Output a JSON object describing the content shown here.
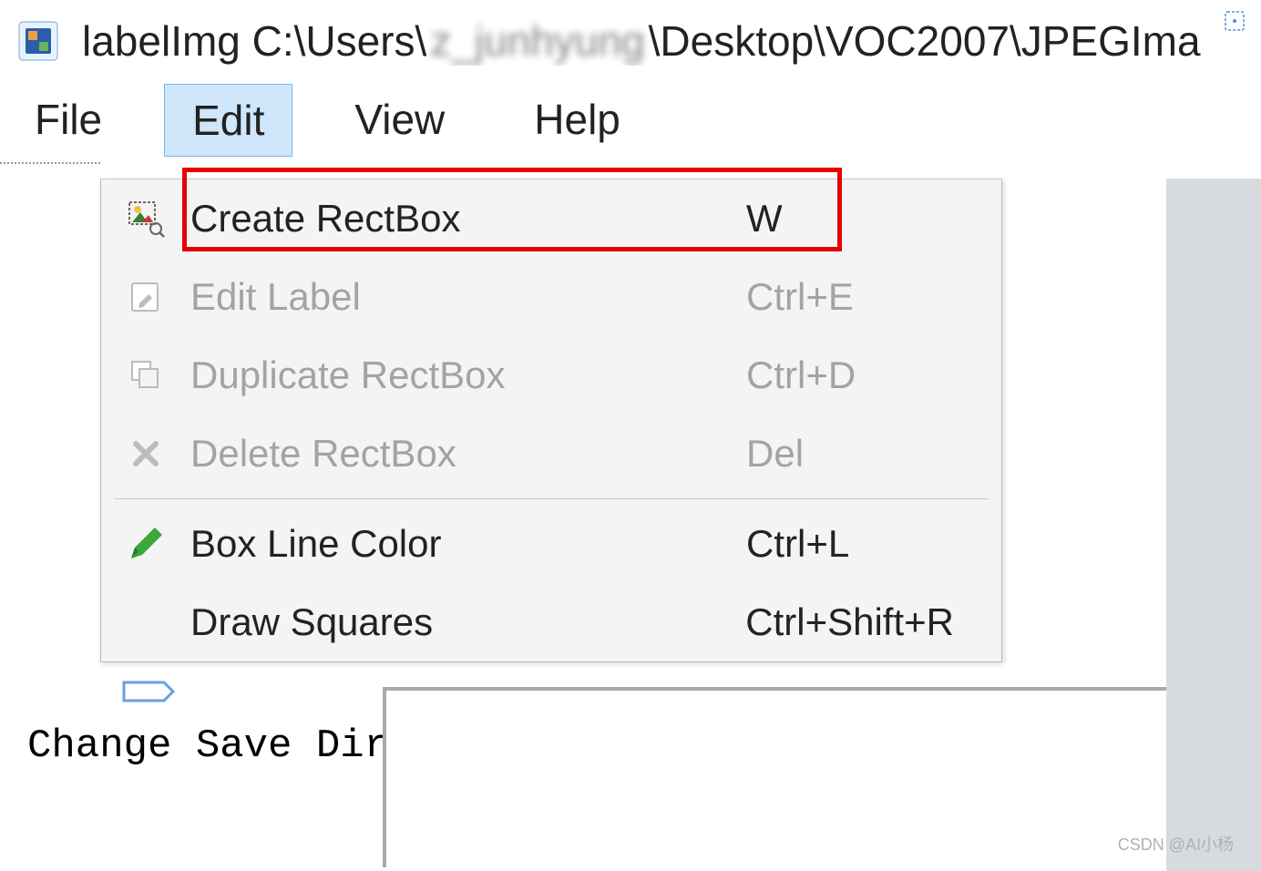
{
  "title": {
    "app_name": "labelImg",
    "path_prefix": "C:\\Users\\",
    "path_blurred": "z_junhyung",
    "path_suffix": "\\Desktop\\VOC2007\\JPEGIma"
  },
  "menubar": {
    "items": [
      "File",
      "Edit",
      "View",
      "Help"
    ],
    "selected_index": 1
  },
  "dropdown": {
    "items": [
      {
        "icon": "create-rect-icon",
        "label": "Create RectBox",
        "shortcut": "W",
        "disabled": false,
        "highlighted": true
      },
      {
        "icon": "edit-icon",
        "label": "Edit Label",
        "shortcut": "Ctrl+E",
        "disabled": true,
        "highlighted": false
      },
      {
        "icon": "duplicate-icon",
        "label": "Duplicate RectBox",
        "shortcut": "Ctrl+D",
        "disabled": true,
        "highlighted": false
      },
      {
        "icon": "delete-icon",
        "label": "Delete RectBox",
        "shortcut": "Del",
        "disabled": true,
        "highlighted": false
      },
      {
        "separator": true
      },
      {
        "icon": "pencil-icon",
        "label": "Box Line Color",
        "shortcut": "Ctrl+L",
        "disabled": false,
        "highlighted": false
      },
      {
        "icon": "",
        "label": "Draw Squares",
        "shortcut": "Ctrl+Shift+R",
        "disabled": false,
        "highlighted": false
      }
    ]
  },
  "toolbar": {
    "change_save_dir": "Change Save Dir"
  },
  "watermark": "CSDN @AI小杨"
}
